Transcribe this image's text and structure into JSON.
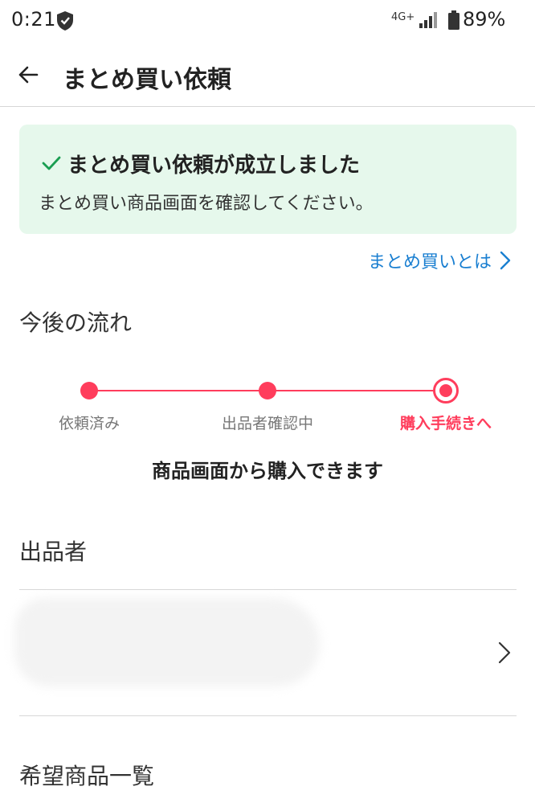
{
  "status_bar": {
    "time": "0:21",
    "network": "4G+",
    "battery": "89%",
    "icons": [
      "shield-icon",
      "signal-icon",
      "battery-icon"
    ]
  },
  "header": {
    "title": "まとめ買い依頼",
    "back_icon": "back-arrow-icon"
  },
  "banner": {
    "title": "まとめ買い依頼が成立しました",
    "message": "まとめ買い商品画面を確認してください。",
    "icon": "check-icon",
    "background": "#e6f8ec",
    "icon_color": "#1a9e52"
  },
  "about_link": {
    "label": "まとめ買いとは",
    "color": "#1a7fd1"
  },
  "flow": {
    "heading": "今後の流れ",
    "steps": [
      {
        "label": "依頼済み",
        "state": "done"
      },
      {
        "label": "出品者確認中",
        "state": "done"
      },
      {
        "label": "購入手続きへ",
        "state": "current"
      }
    ],
    "caption": "商品画面から購入できます",
    "accent": "#ff3d5c"
  },
  "seller": {
    "heading": "出品者",
    "name": ""
  },
  "items": {
    "heading": "希望商品一覧"
  }
}
